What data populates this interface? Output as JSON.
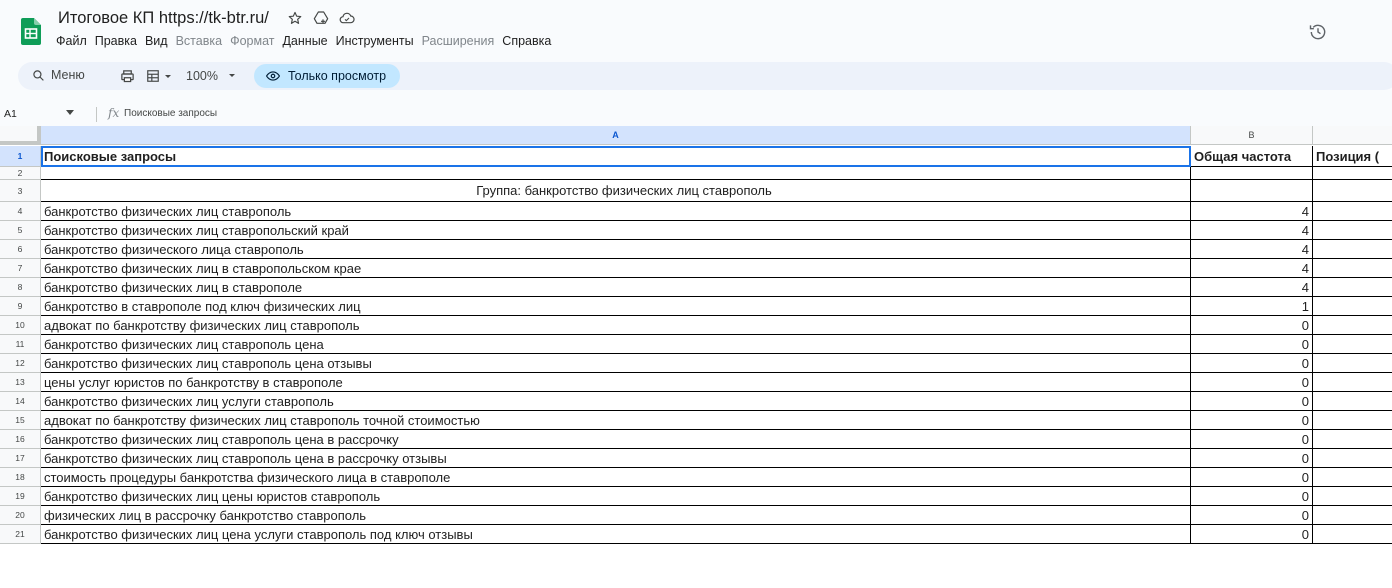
{
  "window": {
    "doc_title": "Итоговое КП https://tk-btr.ru/",
    "menu": [
      {
        "label": "Файл",
        "enabled": true
      },
      {
        "label": "Правка",
        "enabled": true
      },
      {
        "label": "Вид",
        "enabled": true
      },
      {
        "label": "Вставка",
        "enabled": false
      },
      {
        "label": "Формат",
        "enabled": false
      },
      {
        "label": "Данные",
        "enabled": true
      },
      {
        "label": "Инструменты",
        "enabled": true
      },
      {
        "label": "Расширения",
        "enabled": false
      },
      {
        "label": "Справка",
        "enabled": true
      }
    ]
  },
  "toolbar": {
    "search_label": "Меню",
    "zoom": "100%",
    "view_only_label": "Только просмотр"
  },
  "formula_bar": {
    "cell_ref": "A1",
    "value": "Поисковые запросы"
  },
  "grid": {
    "columns": [
      "A",
      "B"
    ],
    "header_row": {
      "a": "Поисковые запросы",
      "b": "Общая частота",
      "c": "Позиция ("
    },
    "group_label": "Группа: банкротство физических лиц ставрополь",
    "rows": [
      {
        "n": "4",
        "query": "банкротство физических лиц ставрополь",
        "freq": "4"
      },
      {
        "n": "5",
        "query": "банкротство физических лиц ставропольский край",
        "freq": "4"
      },
      {
        "n": "6",
        "query": "банкротство физического лица ставрополь",
        "freq": "4"
      },
      {
        "n": "7",
        "query": "банкротство физических лиц в ставропольском крае",
        "freq": "4"
      },
      {
        "n": "8",
        "query": "банкротство физических лиц в ставрополе",
        "freq": "4"
      },
      {
        "n": "9",
        "query": "банкротство в ставрополе под ключ физических лиц",
        "freq": "1"
      },
      {
        "n": "10",
        "query": "адвокат по банкротству физических лиц ставрополь",
        "freq": "0"
      },
      {
        "n": "11",
        "query": "банкротство физических лиц ставрополь цена",
        "freq": "0"
      },
      {
        "n": "12",
        "query": "банкротство физических лиц ставрополь цена отзывы",
        "freq": "0"
      },
      {
        "n": "13",
        "query": "цены услуг юристов по банкротству в ставрополе",
        "freq": "0"
      },
      {
        "n": "14",
        "query": "банкротство физических лиц услуги ставрополь",
        "freq": "0"
      },
      {
        "n": "15",
        "query": "адвокат по банкротству физических лиц ставрополь точной стоимостью",
        "freq": "0"
      },
      {
        "n": "16",
        "query": "банкротство физических лиц ставрополь цена в рассрочку",
        "freq": "0"
      },
      {
        "n": "17",
        "query": "банкротство физических лиц ставрополь цена в рассрочку отзывы",
        "freq": "0"
      },
      {
        "n": "18",
        "query": "стоимость процедуры банкротства физического лица в ставрополе",
        "freq": "0"
      },
      {
        "n": "19",
        "query": "банкротство физических лиц цены юристов ставрополь",
        "freq": "0"
      },
      {
        "n": "20",
        "query": "физических лиц в рассрочку банкротство ставрополь",
        "freq": "0"
      },
      {
        "n": "21",
        "query": "банкротство физических лиц цена услуги ставрополь под ключ отзывы",
        "freq": "0"
      }
    ]
  },
  "colors": {
    "accent": "#1a73e8",
    "view_only_bg": "#c2e7ff",
    "toolbar_bg": "#edf2fa",
    "logo_green": "#0f9d58"
  }
}
